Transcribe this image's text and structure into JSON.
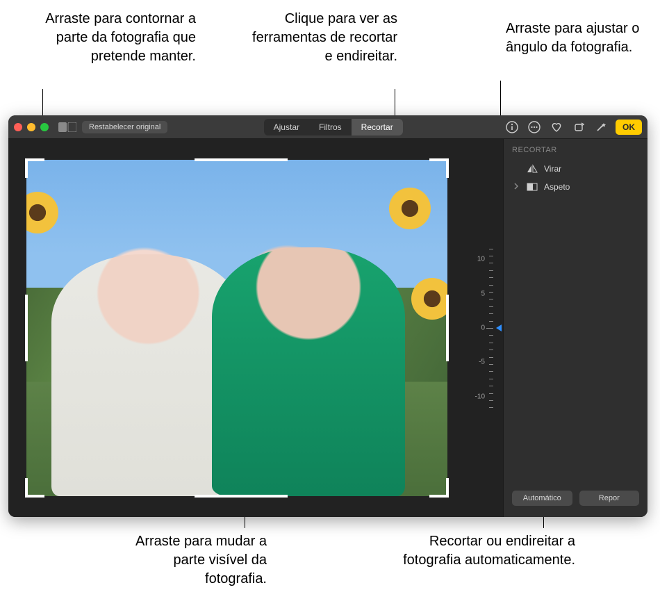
{
  "callouts": {
    "crop_handle": "Arraste para contornar a parte da fotografia que pretende manter.",
    "crop_tab": "Clique para ver as ferramentas de recortar e endireitar.",
    "angle_dial": "Arraste para ajustar o ângulo da fotografia.",
    "drag_photo": "Arraste para mudar a parte visível da fotografia.",
    "auto_btn": "Recortar ou endireitar a fotografia automaticamente."
  },
  "toolbar": {
    "revert_label": "Restabelecer original",
    "segments": {
      "adjust": "Ajustar",
      "filters": "Filtros",
      "crop": "Recortar"
    },
    "done_label": "OK"
  },
  "sidebar": {
    "header": "RECORTAR",
    "flip_label": "Virar",
    "aspect_label": "Aspeto",
    "auto_label": "Automático",
    "reset_label": "Repor"
  },
  "angle": {
    "labels": [
      "10",
      "5",
      "0",
      "-5",
      "-10"
    ],
    "current": "0"
  },
  "icons": {
    "info": "info-icon",
    "more": "more-icon",
    "favorite": "heart-icon",
    "rotate": "rotate-icon",
    "magic": "wand-icon",
    "flip": "flip-icon",
    "aspect": "aspect-icon"
  }
}
